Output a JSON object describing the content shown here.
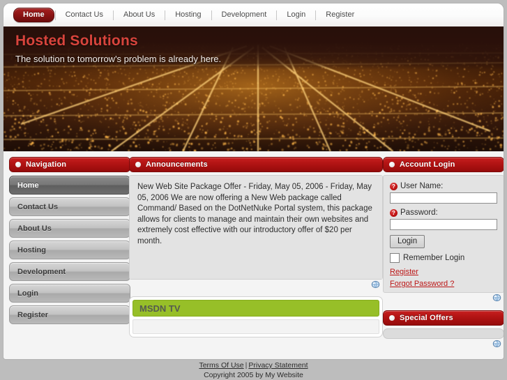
{
  "topnav": {
    "items": [
      {
        "label": "Home",
        "active": true
      },
      {
        "label": "Contact Us",
        "active": false
      },
      {
        "label": "About Us",
        "active": false
      },
      {
        "label": "Hosting",
        "active": false
      },
      {
        "label": "Development",
        "active": false
      },
      {
        "label": "Login",
        "active": false
      },
      {
        "label": "Register",
        "active": false
      }
    ]
  },
  "banner": {
    "heading": "Hosted Solutions",
    "subheading": "The solution to tomorrow's problem is already here.",
    "image_description": "aerial night cityscape with orange street lights",
    "accent_color": "#d8443c"
  },
  "navigation": {
    "title": "Navigation",
    "items": [
      {
        "label": "Home",
        "selected": true
      },
      {
        "label": "Contact Us",
        "selected": false
      },
      {
        "label": "About Us",
        "selected": false
      },
      {
        "label": "Hosting",
        "selected": false
      },
      {
        "label": "Development",
        "selected": false
      },
      {
        "label": "Login",
        "selected": false
      },
      {
        "label": "Register",
        "selected": false
      }
    ]
  },
  "announcements": {
    "title": "Announcements",
    "body": "New Web Site Package Offer - Friday, May 05, 2006 - Friday, May 05, 2006 We are now offering a New Web package called Command/ Based on the DotNetNuke Portal system, this package allows for clients to manage and maintain their own websites and extremely cost effective with our introductory offer of $20 per month."
  },
  "msdn": {
    "title": "MSDN TV",
    "header_color": "#97bf28"
  },
  "account_login": {
    "title": "Account Login",
    "username_label": "User Name:",
    "username_value": "",
    "password_label": "Password:",
    "password_value": "",
    "login_button": "Login",
    "remember_label": "Remember Login",
    "register_link": "Register",
    "forgot_link": "Forgot Password ?",
    "help_glyph": "?"
  },
  "special_offers": {
    "title": "Special Offers"
  },
  "footer": {
    "terms_link": "Terms Of Use",
    "separator": "|",
    "privacy_link": "Privacy Statement",
    "copyright": "Copyright 2005 by My Website"
  },
  "icons": {
    "module_action": "globe-icon"
  },
  "colors": {
    "module_red": "#b31414",
    "page_background": "#bdbdbd",
    "link_red": "#bb1515"
  }
}
